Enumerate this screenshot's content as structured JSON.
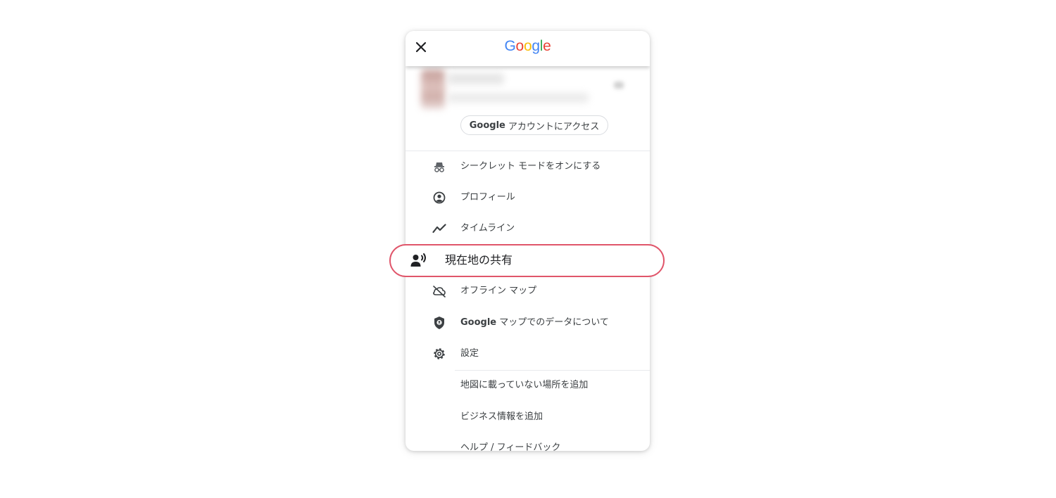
{
  "header": {
    "close_icon": "close-icon",
    "logo_letters": [
      {
        "ch": "G",
        "color": "#4285F4"
      },
      {
        "ch": "o",
        "color": "#EA4335"
      },
      {
        "ch": "o",
        "color": "#FBBC05"
      },
      {
        "ch": "g",
        "color": "#4285F4"
      },
      {
        "ch": "l",
        "color": "#34A853"
      },
      {
        "ch": "e",
        "color": "#EA4335"
      }
    ]
  },
  "account": {
    "button_brand": "Google",
    "button_text": "アカウントにアクセス"
  },
  "menu": {
    "items": [
      {
        "icon": "incognito-icon",
        "label": "シークレット モードをオンにする"
      },
      {
        "icon": "profile-icon",
        "label": "プロフィール"
      },
      {
        "icon": "timeline-icon",
        "label": "タイムライン"
      },
      {
        "icon": "location-sharing-icon",
        "label": "現在地の共有"
      },
      {
        "icon": "offline-maps-icon",
        "label": "オフライン マップ"
      },
      {
        "icon": "shield-icon",
        "label_brand": "Google",
        "label": "マップでのデータについて"
      },
      {
        "icon": "gear-icon",
        "label": "設定"
      },
      {
        "label": "地図に載っていない場所を追加"
      },
      {
        "label": "ビジネス情報を追加"
      },
      {
        "label": "ヘルプ / フィードバック"
      }
    ]
  },
  "colors": {
    "highlight_border": "#e0556a",
    "divider": "#e8eaed",
    "text": "#3c4043"
  }
}
